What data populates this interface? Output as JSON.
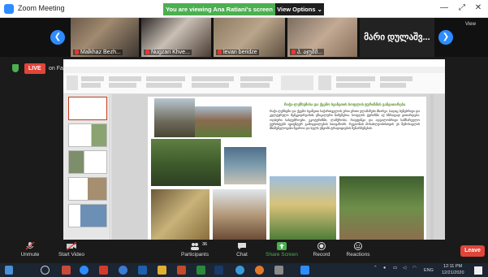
{
  "window": {
    "title": "Zoom Meeting"
  },
  "banner": {
    "sharing": "You are viewing Ana Ratiani's screen",
    "view_options": "View Options ⌄"
  },
  "participants": [
    {
      "name": "Malkhaz Bezh..."
    },
    {
      "name": "Nugzari Khve..."
    },
    {
      "name": "levan beridze"
    },
    {
      "name": "პ. აჯუშშ..."
    }
  ],
  "participant_text_tile": "მარი დულაშვ...",
  "view_label": "View",
  "live": {
    "badge": "LIVE",
    "platform": "on Facebook"
  },
  "presentation": {
    "heading": "რაჭა-ლეჩხუმისა და ქვემო სვანეთის სოფლის ტურიზმის განვითარება",
    "body": "რაჭა-ლეჩხუმი და ქვემო სვანეთი საქართველოს ერთ-ერთი ულამაზესი მხარეა, სადაც ბუნებრივი და კულტურული მემკვიდრეობის უნიკალური ნიმუშებია. სოფლის ტურიზმი აქ სწრაფად ვითარდება: ოჯახური სასტუმროები, ეკოტურიზმი, ლაშქრობა, რაფტინგი და ადგილობრივი სამზარეულო ტურისტებს ავთენტურ გამოცდილებას სთავაზობს. რეგიონის მოსახლეობისთვის ეს შემოსავლის მნიშვნელოვანი წყაროა და ხელს უწყობს ტრადიციების შენარჩუნებას."
  },
  "toolbar": {
    "unmute": "Unmute",
    "start_video": "Start Video",
    "participants": "Participants",
    "participants_count": "36",
    "chat": "Chat",
    "share_screen": "Share Screen",
    "record": "Record",
    "reactions": "Reactions",
    "leave": "Leave"
  },
  "taskbar": {
    "lang": "ENG",
    "time": "12:11 PM",
    "date": "12/21/2020"
  },
  "colors": {
    "zoom_blue": "#2d8cff",
    "share_green": "#4caf50",
    "leave_red": "#e0453a",
    "ppt_orange": "#c43e1c"
  }
}
